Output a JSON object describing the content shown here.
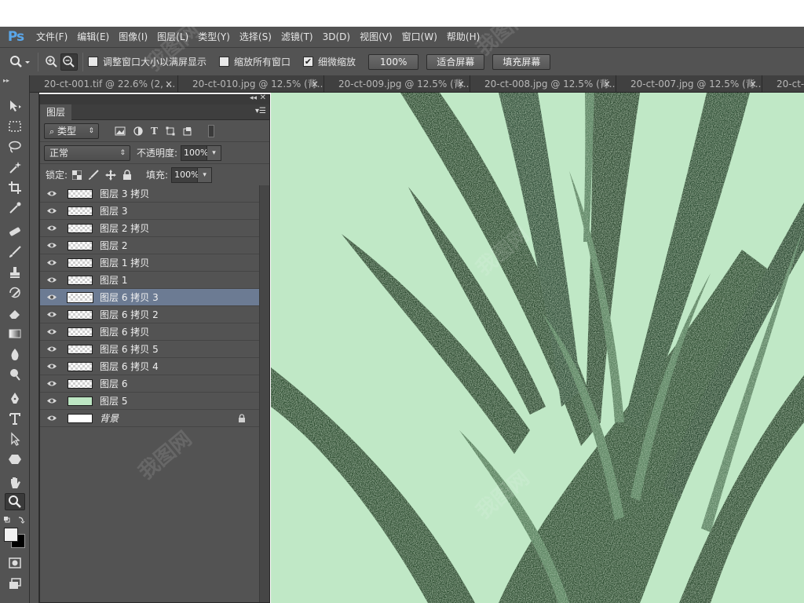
{
  "app": {
    "logo": "Ps"
  },
  "menu": [
    "文件(F)",
    "编辑(E)",
    "图像(I)",
    "图层(L)",
    "类型(Y)",
    "选择(S)",
    "滤镜(T)",
    "3D(D)",
    "视图(V)",
    "窗口(W)",
    "帮助(H)"
  ],
  "options": {
    "resize_windows_label": "调整窗口大小以满屏显示",
    "resize_windows_checked": false,
    "zoom_all_label": "缩放所有窗口",
    "zoom_all_checked": false,
    "scrubby_zoom_label": "细微缩放",
    "scrubby_zoom_checked": true,
    "btn_100": "100%",
    "btn_fit": "适合屏幕",
    "btn_fill": "填充屏幕"
  },
  "tabs": [
    {
      "label": "20-ct-001.tif @ 22.6% (2, ...",
      "close": "×"
    },
    {
      "label": "20-ct-010.jpg @ 12.5% (背...",
      "close": "×"
    },
    {
      "label": "20-ct-009.jpg @ 12.5% (背...",
      "close": "×"
    },
    {
      "label": "20-ct-008.jpg @ 12.5% (背...",
      "close": "×"
    },
    {
      "label": "20-ct-007.jpg @ 12.5% (背...",
      "close": "×"
    },
    {
      "label": "20-ct-0",
      "close": ""
    }
  ],
  "layers_panel": {
    "title": "图层",
    "filter_kind": "类型",
    "blend_mode": "正常",
    "opacity_label": "不透明度:",
    "opacity_value": "100%",
    "lock_label": "锁定:",
    "fill_label": "填充:",
    "fill_value": "100%",
    "layers": [
      {
        "name": "图层 3 拷贝",
        "thumb": "checker",
        "selected": false
      },
      {
        "name": "图层 3",
        "thumb": "checker",
        "selected": false
      },
      {
        "name": "图层 2 拷贝",
        "thumb": "checker",
        "selected": false
      },
      {
        "name": "图层 2",
        "thumb": "checker",
        "selected": false
      },
      {
        "name": "图层 1 拷贝",
        "thumb": "checker",
        "selected": false
      },
      {
        "name": "图层 1",
        "thumb": "checker",
        "selected": false
      },
      {
        "name": "图层 6 拷贝 3",
        "thumb": "checker",
        "selected": true
      },
      {
        "name": "图层 6 拷贝 2",
        "thumb": "checker",
        "selected": false
      },
      {
        "name": "图层 6 拷贝",
        "thumb": "checker",
        "selected": false
      },
      {
        "name": "图层 6 拷贝 5",
        "thumb": "checker",
        "selected": false
      },
      {
        "name": "图层 6 拷贝 4",
        "thumb": "checker",
        "selected": false
      },
      {
        "name": "图层 6",
        "thumb": "checker",
        "selected": false
      },
      {
        "name": "图层 5",
        "thumb": "green",
        "selected": false
      },
      {
        "name": "背景",
        "thumb": "white",
        "selected": false,
        "locked": true
      }
    ]
  },
  "colors": {
    "ui_panel": "#535353",
    "ui_dark": "#3c3c3c",
    "selected_row": "#6c7b93",
    "canvas_bg": "#c0e8c6",
    "leaf_dark": "#2f4f33",
    "leaf_light": "#5d8564",
    "ps_blue": "#5aa7ea"
  }
}
